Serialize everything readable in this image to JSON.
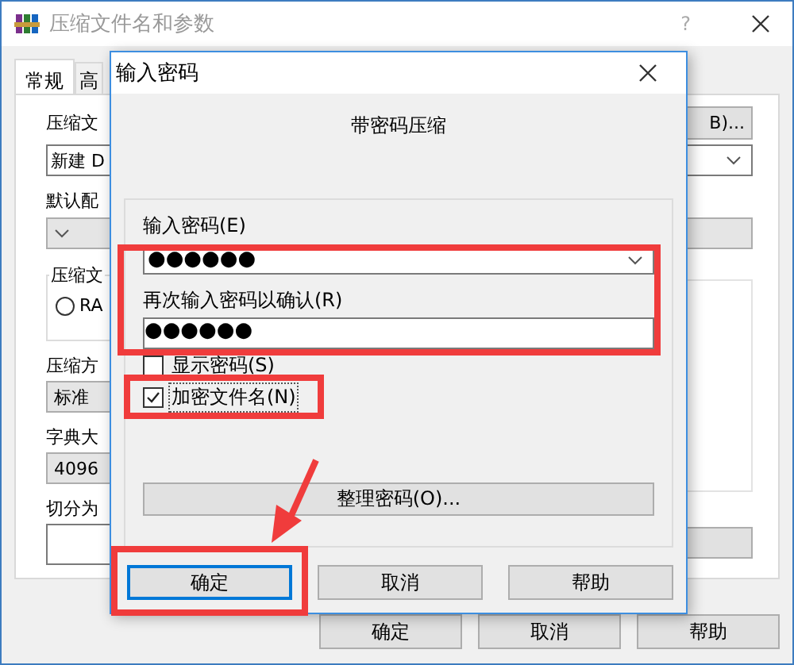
{
  "window": {
    "title": "压缩文件名和参数",
    "help_button": "?"
  },
  "tabs": [
    {
      "label": "常规",
      "selected": true
    },
    {
      "label": "高",
      "selected": false
    }
  ],
  "general": {
    "archive_name_label": "压缩文",
    "browse_button": "B)...",
    "archive_name": "新建 D",
    "profile_label": "默认配",
    "format_group": "压缩文",
    "format_option": {
      "label": "RA",
      "selected": false
    },
    "method_label": "压缩方",
    "method": "标准",
    "dictionary_label": "字典大",
    "dictionary": "4096",
    "split_label": "切分为"
  },
  "buttons": [
    {
      "label": "确定"
    },
    {
      "label": "取消"
    },
    {
      "label": "帮助"
    }
  ],
  "dialog": {
    "title": "输入密码",
    "heading": "带密码压缩",
    "password_section": {
      "highlighted": true,
      "password_label": "输入密码(E)",
      "password": "●●●●●●",
      "confirm_label": "再次输入密码以确认(R)",
      "confirm": "●●●●●●"
    },
    "checkboxes": [
      {
        "label": "显示密码(S)",
        "checked": false,
        "focused": false,
        "highlighted": false
      },
      {
        "label": "加密文件名(N)",
        "checked": true,
        "focused": true,
        "highlighted": true
      }
    ],
    "organize_button": "整理密码(O)...",
    "buttons": [
      {
        "label": "确定",
        "default": true,
        "highlighted": true,
        "arrow": true
      },
      {
        "label": "取消",
        "default": false,
        "highlighted": false,
        "arrow": false
      },
      {
        "label": "帮助",
        "default": false,
        "highlighted": false,
        "arrow": false
      }
    ]
  }
}
